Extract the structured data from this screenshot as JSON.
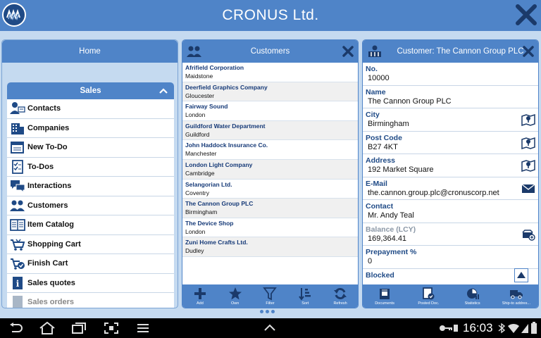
{
  "app": {
    "title": "CRONUS Ltd.",
    "accent": "#4f84c8",
    "background": "#c5daf0"
  },
  "home": {
    "title": "Home",
    "group_title": "Sales",
    "items": [
      {
        "label": "Contacts",
        "icon": "contacts-icon"
      },
      {
        "label": "Companies",
        "icon": "companies-icon"
      },
      {
        "label": "New To-Do",
        "icon": "new-todo-icon"
      },
      {
        "label": "To-Dos",
        "icon": "todos-icon"
      },
      {
        "label": "Interactions",
        "icon": "interactions-icon"
      },
      {
        "label": "Customers",
        "icon": "customers-icon"
      },
      {
        "label": "Item Catalog",
        "icon": "item-catalog-icon"
      },
      {
        "label": "Shopping Cart",
        "icon": "shopping-cart-icon"
      },
      {
        "label": "Finish Cart",
        "icon": "finish-cart-icon"
      },
      {
        "label": "Sales quotes",
        "icon": "sales-quotes-icon"
      },
      {
        "label": "Sales orders",
        "icon": "sales-orders-icon"
      }
    ]
  },
  "customers": {
    "title": "Customers",
    "rows": [
      {
        "name": "Afrifield Corporation",
        "city": "Maidstone"
      },
      {
        "name": "Deerfield Graphics Company",
        "city": "Gloucester"
      },
      {
        "name": "Fairway Sound",
        "city": "London"
      },
      {
        "name": "Guildford Water Department",
        "city": "Guildford"
      },
      {
        "name": "John Haddock Insurance Co.",
        "city": "Manchester"
      },
      {
        "name": "London Light Company",
        "city": "Cambridge"
      },
      {
        "name": "Selangorian Ltd.",
        "city": "Coventry"
      },
      {
        "name": "The Cannon Group PLC",
        "city": "Birmingham"
      },
      {
        "name": "The Device Shop",
        "city": "London"
      },
      {
        "name": "Zuni Home Crafts Ltd.",
        "city": "Dudley"
      }
    ],
    "toolbar": [
      "Add",
      "Own",
      "Filter",
      "Sort",
      "Refresh"
    ]
  },
  "card": {
    "title": "Customer: The Cannon Group PLC",
    "fields": [
      {
        "label": "No.",
        "value": "10000",
        "icon": ""
      },
      {
        "label": "Name",
        "value": "The Cannon Group PLC",
        "icon": ""
      },
      {
        "label": "City",
        "value": "Birmingham",
        "icon": "map-icon"
      },
      {
        "label": "Post Code",
        "value": "B27 4KT",
        "icon": "map-icon"
      },
      {
        "label": "Address",
        "value": "192 Market Square",
        "icon": "map-icon"
      },
      {
        "label": "E-Mail",
        "value": "the.cannon.group.plc@cronuscorp.net",
        "icon": "email-icon"
      },
      {
        "label": "Contact",
        "value": "Mr. Andy Teal",
        "icon": ""
      },
      {
        "label": "Balance (LCY)",
        "value": "169,364.41",
        "icon": "balance-icon"
      },
      {
        "label": "Prepayment %",
        "value": "0",
        "icon": ""
      },
      {
        "label": "Blocked",
        "value": "",
        "icon": ""
      }
    ],
    "toolbar": [
      "Documents",
      "Posted Doc.",
      "Statistics",
      "Ship-to addres..."
    ]
  },
  "status": {
    "time": "16:03"
  }
}
